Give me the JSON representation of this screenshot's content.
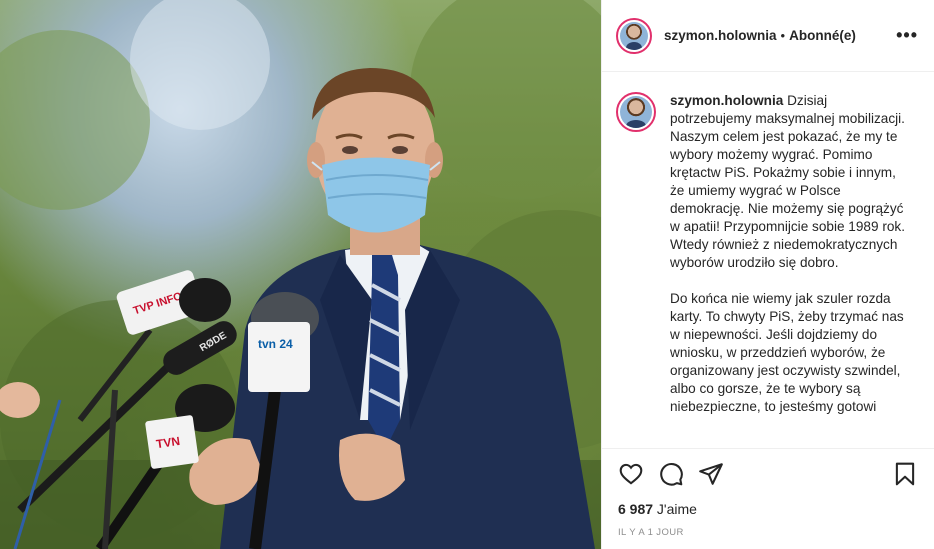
{
  "post": {
    "username": "szymon.holownia",
    "separator": "•",
    "follow_label": "Abonné(e)",
    "more_label": "•••",
    "caption_user": "szymon.holownia",
    "caption": " Dzisiaj potrzebujemy maksymalnej mobilizacji. Naszym celem jest pokazać, że my te wybory możemy wygrać. Pomimo krętactw PiS. Pokażmy sobie i innym, że umiemy wygrać w Polsce demokrację. Nie możemy się pogrążyć w apatii! Przypomnijcie sobie 1989 rok. Wtedy również z niedemokratycznych wyborów urodziło się dobro.\n\nDo końca nie wiemy jak szuler rozda karty. To chwyty PiS, żeby trzymać nas w niepewności. Jeśli dojdziemy do wniosku, w przeddzień wyborów, że organizowany jest oczywisty szwindel, albo co gorsze, że te wybory są niebezpieczne, to jesteśmy gotowi",
    "likes_count": "6 987",
    "likes_label": " J'aime",
    "time_ago": "IL Y A 1 JOUR"
  },
  "photo": {
    "mic_labels": [
      "TVP INFO",
      "RØDE",
      "tvn 24",
      "TVN"
    ]
  },
  "icons": {
    "like": "heart-icon",
    "comment": "comment-bubble-icon",
    "share": "paper-plane-icon",
    "save": "bookmark-icon",
    "more": "ellipsis-icon"
  },
  "colors": {
    "story_ring": "#e1306c",
    "text": "#262626",
    "muted": "#8e8e8e",
    "border": "#efefef"
  }
}
